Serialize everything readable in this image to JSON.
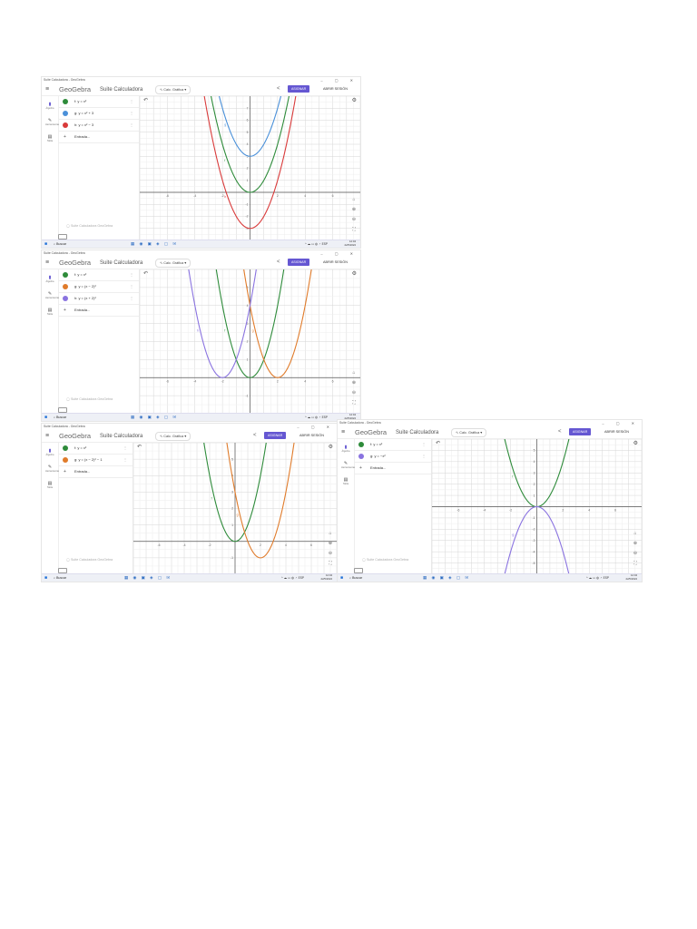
{
  "app": {
    "window_title": "Suite Calculadora - GeoGebra",
    "logo": "GeoGebra",
    "suite": "Suite Calculadora",
    "dropdown": "Calc. Gráfica",
    "assign_button": "ASIGNAR",
    "signin_button": "ABRIR SESIÓN",
    "input_placeholder": "Entrada...",
    "brand_footer": "Suite Calculadora GeoGebra",
    "rail": [
      "Álgebra",
      "Herramientas",
      "Tabla"
    ]
  },
  "taskbar": {
    "search": "Buscar",
    "lang": "ESP",
    "time": "12:04",
    "date": "22/5/2024"
  },
  "colors": {
    "green": "#2e8b3a",
    "blue": "#4a90d9",
    "red": "#d93a3a",
    "orange": "#e07b2a",
    "purple": "#8a73e0",
    "accent": "#6557d2"
  },
  "shots": [
    {
      "expressions": [
        {
          "text": "f: y = x²",
          "color": "#2e8b3a"
        },
        {
          "text": "g: y = x² + 3",
          "color": "#4a90d9"
        },
        {
          "text": "h: y = x² − 3",
          "color": "#d93a3a"
        }
      ],
      "curves": [
        {
          "h": 0,
          "k": 0,
          "a": 1,
          "color": "#2e8b3a",
          "label": "f"
        },
        {
          "h": 0,
          "k": 3,
          "a": 1,
          "color": "#4a90d9",
          "label": "g"
        },
        {
          "h": 0,
          "k": -3,
          "a": 1,
          "color": "#d93a3a",
          "label": "h"
        }
      ],
      "xrange": [
        -8,
        8
      ],
      "yrange": [
        -4,
        8
      ]
    },
    {
      "expressions": [
        {
          "text": "f: y = x²",
          "color": "#2e8b3a"
        },
        {
          "text": "g: y = (x − 2)²",
          "color": "#e07b2a"
        },
        {
          "text": "h: y = (x + 2)²",
          "color": "#8a73e0"
        }
      ],
      "curves": [
        {
          "h": 0,
          "k": 0,
          "a": 1,
          "color": "#2e8b3a",
          "label": "f"
        },
        {
          "h": 2,
          "k": 0,
          "a": 1,
          "color": "#e07b2a",
          "label": "g"
        },
        {
          "h": -2,
          "k": 0,
          "a": 1,
          "color": "#8a73e0",
          "label": "h"
        }
      ],
      "xrange": [
        -8,
        8
      ],
      "yrange": [
        -2,
        6
      ]
    },
    {
      "expressions": [
        {
          "text": "f: y = x²",
          "color": "#2e8b3a"
        },
        {
          "text": "g: y = (x − 2)² − 1",
          "color": "#e07b2a"
        }
      ],
      "curves": [
        {
          "h": 0,
          "k": 0,
          "a": 1,
          "color": "#2e8b3a",
          "label": "f"
        },
        {
          "h": 2,
          "k": -1,
          "a": 1,
          "color": "#e07b2a",
          "label": "g"
        }
      ],
      "xrange": [
        -8,
        8
      ],
      "yrange": [
        -2,
        6
      ]
    },
    {
      "expressions": [
        {
          "text": "f: y = x²",
          "color": "#2e8b3a"
        },
        {
          "text": "g: y = −x²",
          "color": "#8a73e0"
        }
      ],
      "curves": [
        {
          "h": 0,
          "k": 0,
          "a": 1,
          "color": "#2e8b3a",
          "label": "f"
        },
        {
          "h": 0,
          "k": 0,
          "a": -1,
          "color": "#8a73e0",
          "label": "g"
        }
      ],
      "xrange": [
        -8,
        8
      ],
      "yrange": [
        -6,
        6
      ]
    }
  ]
}
